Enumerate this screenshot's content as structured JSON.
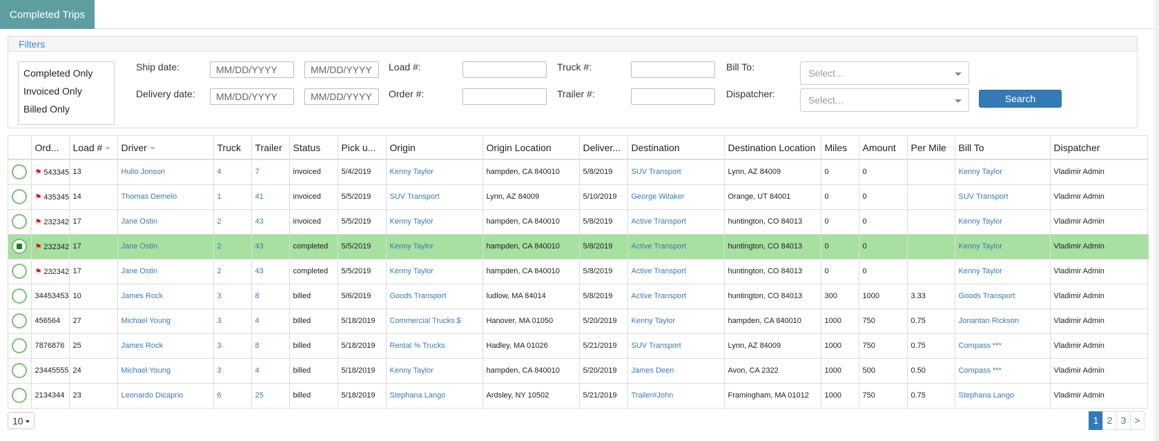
{
  "tabs": {
    "active_label": "Completed Trips"
  },
  "filters": {
    "title": "Filters",
    "status_options": [
      "Completed Only",
      "Invoiced Only",
      "Billed Only"
    ],
    "ship_date_label": "Ship date:",
    "delivery_date_label": "Delivery date:",
    "date_placeholder": "MM/DD/YYYY",
    "load_label": "Load #:",
    "order_label": "Order #:",
    "truck_label": "Truck #:",
    "trailer_label": "Trailer #:",
    "bill_to_label": "Bill To:",
    "dispatcher_label": "Dispatcher:",
    "select_placeholder": "Select...",
    "search_label": "Search"
  },
  "table": {
    "columns": [
      "Ord...",
      "Load #",
      "Driver",
      "Truck",
      "Trailer",
      "Status",
      "Pick u...",
      "Origin",
      "Origin Location",
      "Deliver...",
      "Destination",
      "Destination Location",
      "Miles",
      "Amount",
      "Per Mile",
      "Bill To",
      "Dispatcher"
    ],
    "rows": [
      {
        "selected": false,
        "flag": true,
        "cells": [
          "543345",
          "13",
          "Hulio Jonson",
          "4",
          "7",
          "invoiced",
          "5/4/2019",
          "Kenny Taylor",
          "hampden, CA 840010",
          "5/8/2019",
          "SUV Transport",
          "Lynn, AZ 84009",
          "0",
          "0",
          "",
          "Kenny Taylor",
          "Vladimir Admin"
        ]
      },
      {
        "selected": false,
        "flag": true,
        "cells": [
          "435345",
          "14",
          "Thomas Demelo",
          "1",
          "41",
          "invoiced",
          "5/5/2019",
          "SUV Transport",
          "Lynn, AZ 84009",
          "5/10/2019",
          "George Witaker",
          "Orange, UT 84001",
          "0",
          "0",
          "",
          "SUV Transport",
          "Vladimir Admin"
        ]
      },
      {
        "selected": false,
        "flag": true,
        "cells": [
          "232342",
          "17",
          "Jane Ostin",
          "2",
          "43",
          "invoiced",
          "5/5/2019",
          "Kenny Taylor",
          "hampden, CA 840010",
          "5/8/2019",
          "Active Transport",
          "huntington, CO 84013",
          "0",
          "0",
          "",
          "Kenny Taylor",
          "Vladimir Admin"
        ]
      },
      {
        "selected": true,
        "flag": true,
        "cells": [
          "232342",
          "17",
          "Jane Ostin",
          "2",
          "43",
          "completed",
          "5/5/2019",
          "Kenny Taylor",
          "hampden, CA 840010",
          "5/8/2019",
          "Active Transport",
          "huntington, CO 84013",
          "0",
          "0",
          "",
          "Kenny Taylor",
          "Vladimir Admin"
        ]
      },
      {
        "selected": false,
        "flag": true,
        "cells": [
          "232342",
          "17",
          "Jane Ostin",
          "2",
          "43",
          "completed",
          "5/5/2019",
          "Kenny Taylor",
          "hampden, CA 840010",
          "5/8/2019",
          "Active Transport",
          "huntington, CO 84013",
          "0",
          "0",
          "",
          "Kenny Taylor",
          "Vladimir Admin"
        ]
      },
      {
        "selected": false,
        "flag": false,
        "cells": [
          "34453453",
          "10",
          "James Rock",
          "3",
          "8",
          "billed",
          "5/6/2019",
          "Goods Transport",
          "ludlow, MA 84014",
          "5/8/2019",
          "Active Transport",
          "huntington, CO 84013",
          "300",
          "1000",
          "3.33",
          "Goods Transport",
          "Vladimir Admin"
        ]
      },
      {
        "selected": false,
        "flag": false,
        "cells": [
          "456564",
          "27",
          "Michael Young",
          "3",
          "4",
          "billed",
          "5/18/2019",
          "Commercial Trucks $",
          "Hanover, MA 01050",
          "5/20/2019",
          "Kenny Taylor",
          "hampden, CA 840010",
          "1000",
          "750",
          "0.75",
          "Jonantan Rickson",
          "Vladimir Admin"
        ]
      },
      {
        "selected": false,
        "flag": false,
        "cells": [
          "7876876",
          "25",
          "James Rock",
          "3",
          "8",
          "billed",
          "5/18/2019",
          "Rental % Trucks",
          "Hadley, MA 01026",
          "5/21/2019",
          "SUV Transport",
          "Lynn, AZ 84009",
          "1000",
          "750",
          "0.75",
          "Compass ***",
          "Vladimir Admin"
        ]
      },
      {
        "selected": false,
        "flag": false,
        "cells": [
          "23445555",
          "24",
          "Michael Young",
          "3",
          "4",
          "billed",
          "5/18/2019",
          "Kenny Taylor",
          "hampden, CA 840010",
          "5/20/2019",
          "James Deen",
          "Avon, CA 2322",
          "1000",
          "500",
          "0.50",
          "Compass ***",
          "Vladimir Admin"
        ]
      },
      {
        "selected": false,
        "flag": false,
        "cells": [
          "2134344",
          "23",
          "Leonardo Dicaprio",
          "6",
          "25",
          "billed",
          "5/18/2019",
          "Stephana Lango",
          "Ardsley, NY 10502",
          "5/21/2019",
          "Trailer#John",
          "Framingham, MA 01012",
          "1000",
          "750",
          "0.75",
          "Stephana Lango",
          "Vladimir Admin"
        ]
      }
    ]
  },
  "pagination": {
    "page_size": "10",
    "pages": [
      "1",
      "2",
      "3"
    ],
    "active_page": "1",
    "next_label": ">"
  },
  "colors": {
    "tab": "#5f9ea0",
    "selected_row": "#a7e0a1",
    "link": "#3a79b3",
    "primary_button": "#337ab7",
    "flag": "#d9141b",
    "radio_border": "#7cbf74"
  }
}
